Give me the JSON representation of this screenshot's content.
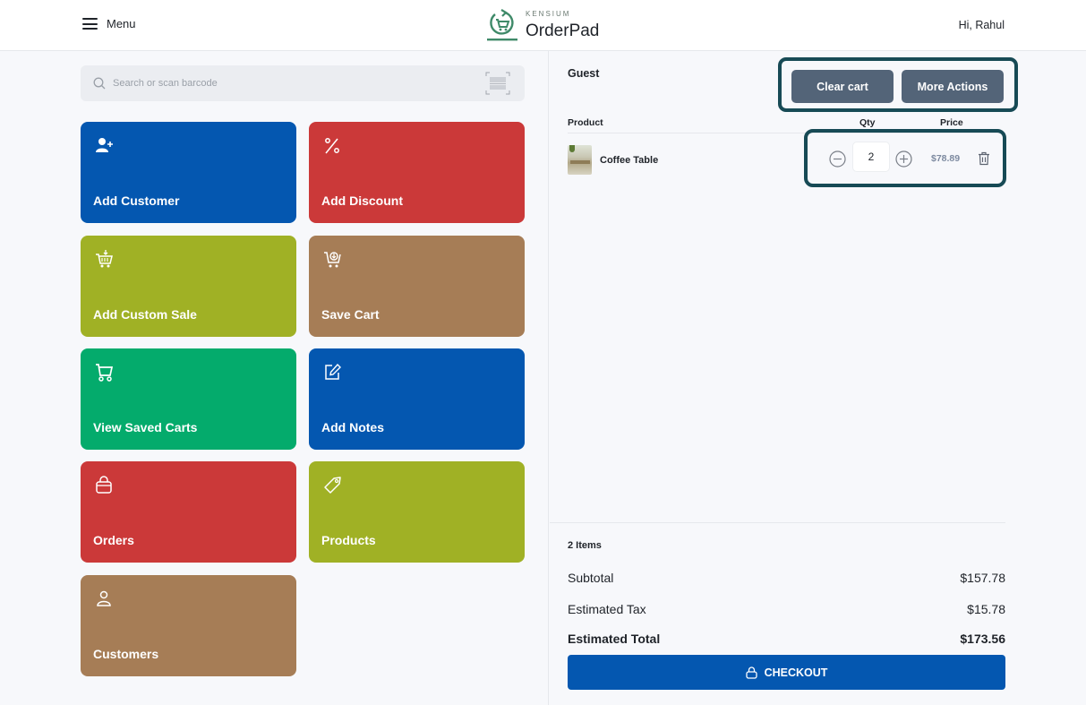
{
  "header": {
    "menu_label": "Menu",
    "logo_brand": "KENSIUM",
    "logo_name": "OrderPad",
    "greeting": "Hi, Rahul"
  },
  "search": {
    "placeholder": "Search or scan barcode",
    "value": "",
    "icon": "search-icon",
    "barcode_icon": "barcode-scan-icon"
  },
  "tiles": [
    {
      "label": "Add Customer",
      "icon": "user-plus-icon",
      "color": "#0457b0"
    },
    {
      "label": "Add Discount",
      "icon": "percent-icon",
      "color": "#cb3939"
    },
    {
      "label": "Add Custom Sale",
      "icon": "cart-add-icon",
      "color": "#a0b125"
    },
    {
      "label": "Save Cart",
      "icon": "cart-save-icon",
      "color": "#a67d56"
    },
    {
      "label": "View Saved Carts",
      "icon": "cart-icon",
      "color": "#04ab6c"
    },
    {
      "label": "Add Notes",
      "icon": "edit-icon",
      "color": "#0457b0"
    },
    {
      "label": "Orders",
      "icon": "shopping-bag-icon",
      "color": "#cb3939"
    },
    {
      "label": "Products",
      "icon": "tag-icon",
      "color": "#a0b125"
    },
    {
      "label": "Customers",
      "icon": "user-icon",
      "color": "#a67d56"
    }
  ],
  "cart": {
    "customer": "Guest",
    "clear_label": "Clear cart",
    "more_label": "More Actions",
    "columns": {
      "product": "Product",
      "qty": "Qty",
      "price": "Price"
    },
    "items": [
      {
        "name": "Coffee Table",
        "qty": "2",
        "price": "$78.89"
      }
    ],
    "summary": {
      "items_count": "2 Items",
      "subtotal_label": "Subtotal",
      "subtotal": "$157.78",
      "tax_label": "Estimated Tax",
      "tax": "$15.78",
      "total_label": "Estimated Total",
      "total": "$173.56"
    },
    "checkout_label": "CHECKOUT"
  },
  "colors": {
    "accent": "#0457b0",
    "highlight_border": "#174a55",
    "gray_button": "#536478"
  }
}
